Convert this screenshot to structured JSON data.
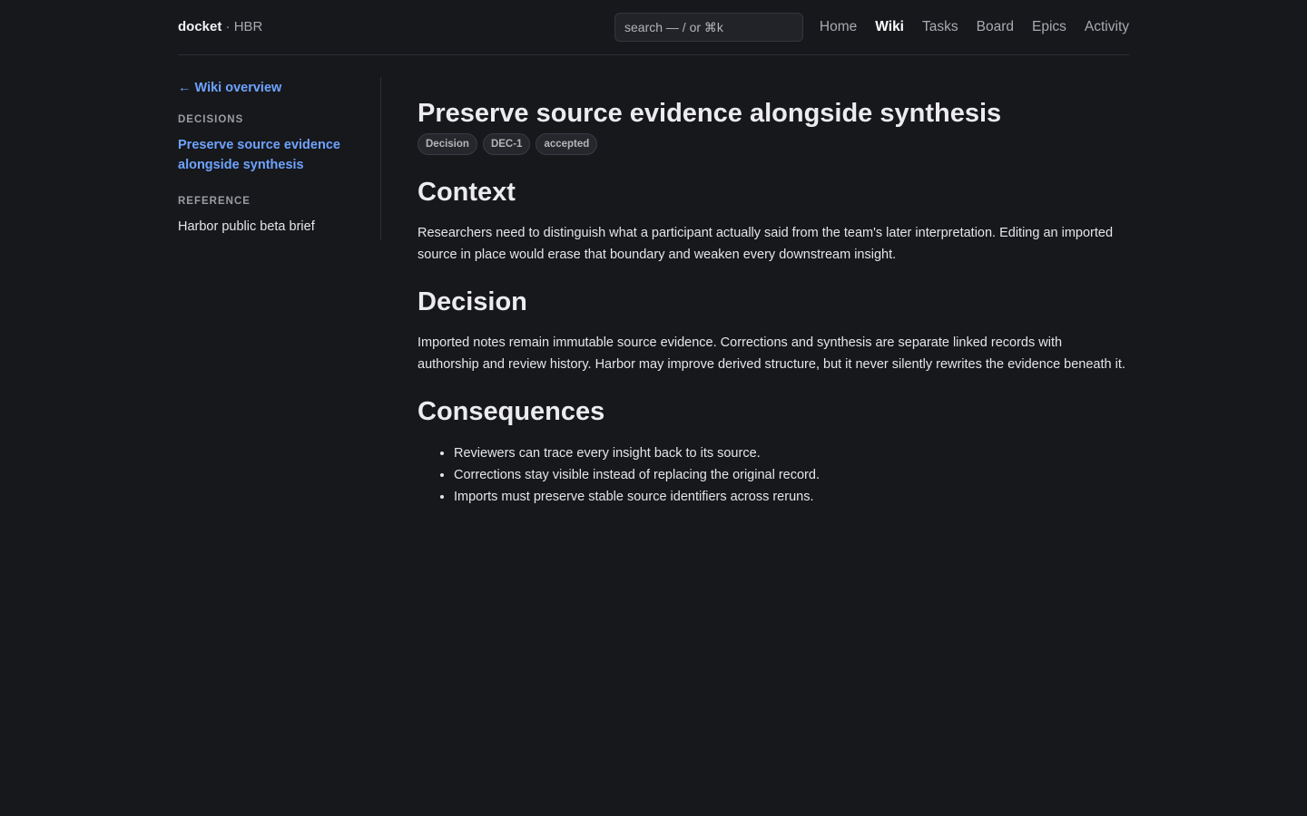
{
  "header": {
    "brand_name": "docket",
    "brand_separator": " · ",
    "workspace": "HBR",
    "search_placeholder": "search — / or ⌘k",
    "nav": [
      "Home",
      "Wiki",
      "Tasks",
      "Board",
      "Epics",
      "Activity"
    ],
    "active_nav": "Wiki"
  },
  "sidebar": {
    "back_label": "← Wiki overview",
    "sections": [
      {
        "label": "DECISIONS",
        "items": [
          "Preserve source evidence alongside synthesis"
        ]
      },
      {
        "label": "REFERENCE",
        "items": [
          "Harbor public beta brief"
        ]
      }
    ],
    "current_item": "Preserve source evidence alongside synthesis"
  },
  "page": {
    "title": "Preserve source evidence alongside synthesis",
    "badges": [
      "Decision",
      "DEC-1",
      "accepted"
    ],
    "context_heading": "Context",
    "context_text": "Researchers need to distinguish what a participant actually said from the team's later interpretation. Editing an imported source in place would erase that boundary and weaken every downstream insight.",
    "decision_heading": "Decision",
    "decision_text": "Imported notes remain immutable source evidence. Corrections and synthesis are separate linked records with authorship and review history. Harbor may improve derived structure, but it never silently rewrites the evidence beneath it.",
    "consequences_heading": "Consequences",
    "consequences": [
      "Reviewers can trace every insight back to its source.",
      "Corrections stay visible instead of replacing the original record.",
      "Imports must preserve stable source identifiers across reruns."
    ]
  },
  "colors": {
    "background": "#17181c",
    "accent": "#6ea3ff",
    "text": "#e6e6e9",
    "muted": "#a9aab1"
  }
}
